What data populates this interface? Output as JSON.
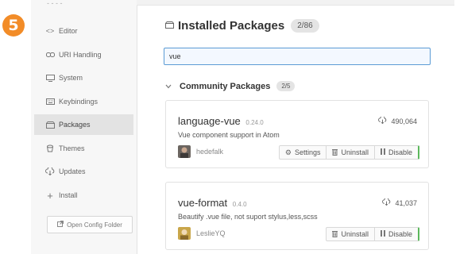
{
  "step_number": "5",
  "sidebar": {
    "items": [
      {
        "icon": "code-icon",
        "label": "Editor"
      },
      {
        "icon": "link-icon",
        "label": "URI Handling"
      },
      {
        "icon": "monitor-icon",
        "label": "System"
      },
      {
        "icon": "keyboard-icon",
        "label": "Keybindings"
      },
      {
        "icon": "package-icon",
        "label": "Packages",
        "active": true
      },
      {
        "icon": "paintcan-icon",
        "label": "Themes"
      },
      {
        "icon": "cloud-download-icon",
        "label": "Updates"
      },
      {
        "icon": "plus-icon",
        "label": "Install"
      }
    ],
    "open_config_label": "Open Config Folder"
  },
  "main": {
    "installed_title": "Installed Packages",
    "installed_count": "2/86",
    "search_value": "vue",
    "community_title": "Community Packages",
    "community_count": "2/5",
    "packages": [
      {
        "name": "language-vue",
        "version": "0.24.0",
        "downloads": "490,064",
        "description": "Vue component support in Atom",
        "author": "hedefalk",
        "buttons": [
          "Settings",
          "Uninstall",
          "Disable"
        ]
      },
      {
        "name": "vue-format",
        "version": "0.4.0",
        "downloads": "41,037",
        "description": "Beautify .vue file, not suport stylus,less,scss",
        "author": "LeslieYQ",
        "buttons": [
          "Uninstall",
          "Disable"
        ]
      }
    ]
  },
  "colors": {
    "badge": "#f28c28",
    "focus_border": "#5b9bd5",
    "enabled_indicator": "#5cb85c"
  }
}
